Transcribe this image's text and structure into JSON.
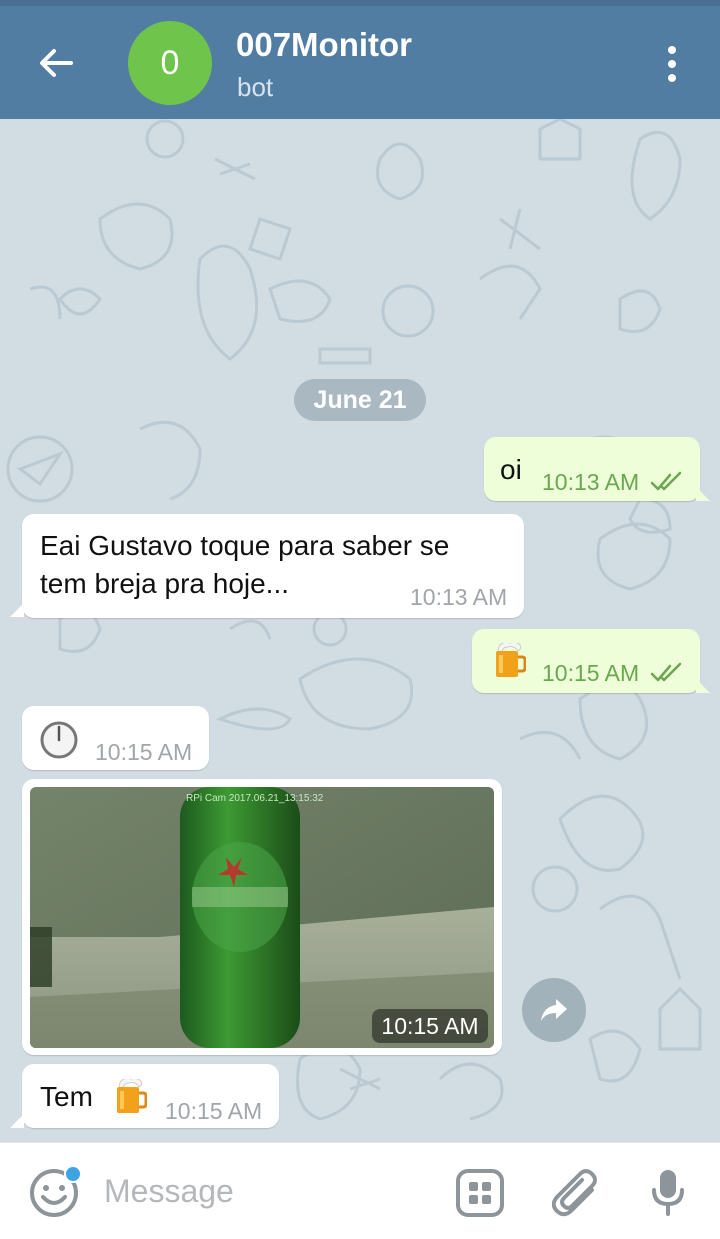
{
  "header": {
    "avatar_letter": "0",
    "title": "007Monitor",
    "subtitle": "bot"
  },
  "chat": {
    "date_label": "June 21",
    "messages": [
      {
        "direction": "out",
        "text": "oi",
        "time": "10:13 AM",
        "status": "read"
      },
      {
        "direction": "in",
        "text_line1": "Eai Gustavo toque para saber se",
        "text_line2": "tem breja pra hoje...",
        "time": "10:13 AM"
      },
      {
        "direction": "out",
        "emoji": "beer-mug",
        "time": "10:15 AM",
        "status": "read"
      },
      {
        "direction": "in",
        "emoji": "clock",
        "time": "10:15 AM"
      },
      {
        "direction": "in",
        "photo_caption_overlay": "RPi Cam 2017.06.21_13:15:32",
        "time": "10:15 AM"
      },
      {
        "direction": "in",
        "text": "Tem",
        "emoji": "beer-mug",
        "time": "10:15 AM"
      }
    ]
  },
  "composer": {
    "placeholder": "Message"
  },
  "colors": {
    "header": "#527da3",
    "avatar": "#6fc44b",
    "outgoing_bubble": "#eefed9",
    "incoming_bubble": "#ffffff",
    "chat_background": "#d2dce3",
    "read_check": "#6aa84f",
    "notification_dot": "#3ea3e5"
  }
}
